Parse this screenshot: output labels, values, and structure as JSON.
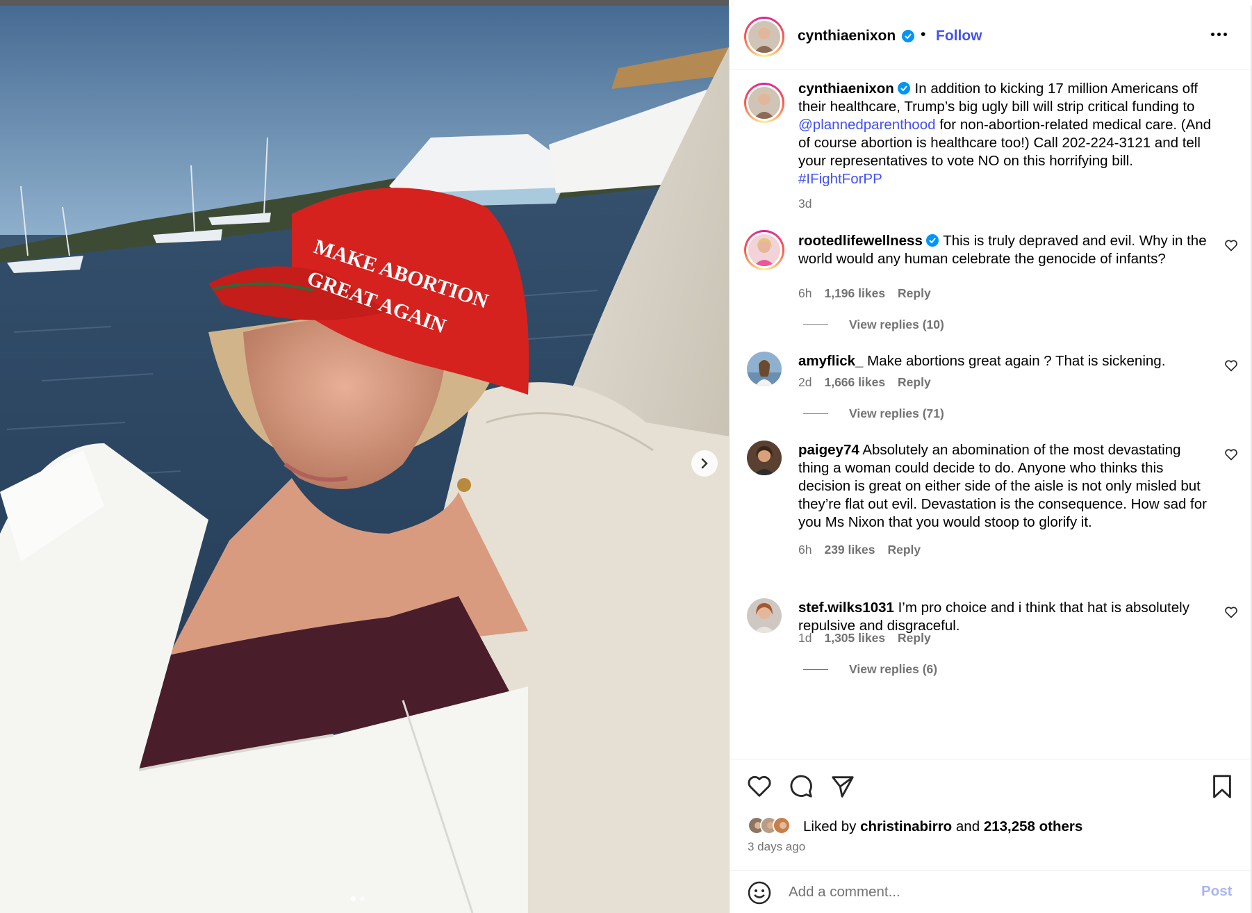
{
  "post": {
    "hat_text_line1": "MAKE ABORTION",
    "hat_text_line2": "GREAT AGAIN"
  },
  "header": {
    "username": "cynthiaenixon",
    "separator": "•",
    "follow_label": "Follow"
  },
  "caption": {
    "username": "cynthiaenixon",
    "text_before_mention": "In addition to kicking 17 million Americans off their healthcare, Trump’s big ugly bill will strip critical funding to ",
    "mention": "@plannedparenthood",
    "text_after_mention": " for non-abortion-related medical care. (And of course abortion is healthcare too!) Call 202-224-3121 and tell your representatives to vote NO on this horrifying bill.",
    "hashtag": "#IFightForPP",
    "time": "3d"
  },
  "comments": [
    {
      "username": "rootedlifewellness",
      "verified": true,
      "text": "This is truly depraved and evil. Why in the world would any human celebrate the genocide of infants?",
      "time": "6h",
      "likes": "1,196 likes",
      "reply_label": "Reply",
      "view_replies": "View replies (10)"
    },
    {
      "username": "amyflick_",
      "verified": false,
      "text": "Make abortions great again ? That is sickening.",
      "time": "2d",
      "likes": "1,666 likes",
      "reply_label": "Reply",
      "view_replies": "View replies (71)"
    },
    {
      "username": "paigey74",
      "verified": false,
      "text": "Absolutely an abomination of the most devastating thing a woman could decide to do. Anyone who thinks this decision is great on either side of the aisle is not only misled but they’re flat out evil. Devastation is the consequence. How sad for you Ms Nixon that you would stoop to glorify it.",
      "time": "6h",
      "likes": "239 likes",
      "reply_label": "Reply",
      "view_replies": ""
    },
    {
      "username": "stef.wilks1031",
      "verified": false,
      "text": "I’m pro choice and i think that hat is absolutely repulsive and disgraceful.",
      "time": "1d",
      "likes": "1,305 likes",
      "reply_label": "Reply",
      "view_replies": "View replies (6)"
    }
  ],
  "actions": {
    "icons": [
      "heart-icon",
      "comment-icon",
      "share-icon",
      "bookmark-icon"
    ],
    "liked_by_prefix": "Liked by",
    "liked_by_user": "christinabirro",
    "liked_by_and": "and",
    "liked_by_others": "213,258 others",
    "time_ago": "3 days ago"
  },
  "add_comment": {
    "placeholder": "Add a comment...",
    "post_label": "Post"
  },
  "colors": {
    "link": "#4150f7",
    "verified": "#0095f6",
    "muted": "#737373",
    "post_disabled": "#a8b6f5",
    "hat_red": "#d5221f"
  },
  "carousel": {
    "current": 1,
    "total": 3
  }
}
